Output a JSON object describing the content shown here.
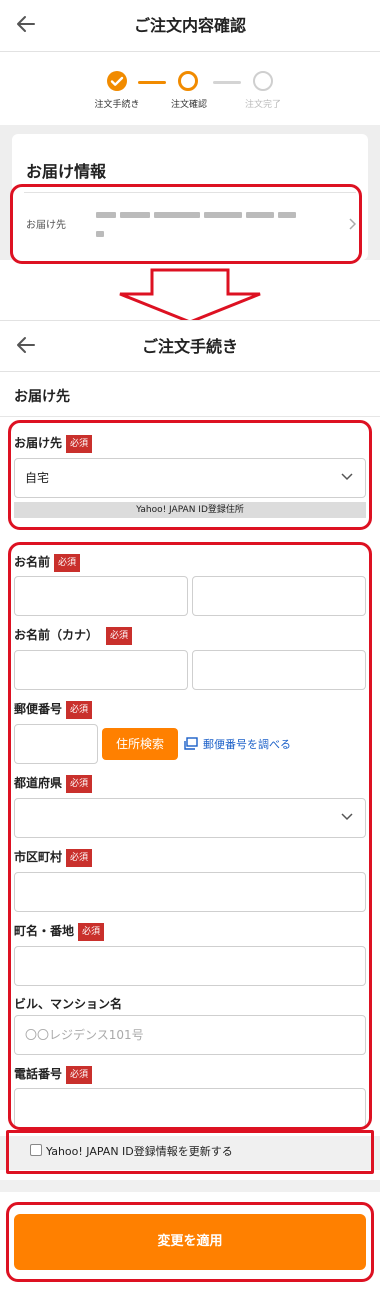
{
  "top_screen": {
    "header_title": "ご注文内容確認",
    "steps": [
      {
        "label": "注文手続き",
        "state": "done"
      },
      {
        "label": "注文確認",
        "state": "current"
      },
      {
        "label": "注文完了",
        "state": "pending"
      }
    ],
    "card_title": "お届け情報",
    "address_label": "お届け先"
  },
  "bottom_screen": {
    "header_title": "ご注文手続き",
    "section_title": "お届け先",
    "required_badge": "必須",
    "delivery": {
      "label": "お届け先",
      "selected": "自宅",
      "note": "Yahoo! JAPAN ID登録住所"
    },
    "fields": {
      "name_label": "お名前",
      "kana_label": "お名前（カナ）",
      "postal_label": "郵便番号",
      "address_search_button": "住所検索",
      "postal_lookup_link": "郵便番号を調べる",
      "prefecture_label": "都道府県",
      "city_label": "市区町村",
      "street_label": "町名・番地",
      "building_label": "ビル、マンション名",
      "building_placeholder": "〇〇レジデンス101号",
      "phone_label": "電話番号"
    },
    "update_checkbox_label": "Yahoo! JAPAN ID登録情報を更新する",
    "apply_button": "変更を適用"
  },
  "colors": {
    "accent": "#ff8000",
    "highlight": "#dd1122",
    "required": "#c9302c",
    "link": "#1a5fc8"
  }
}
